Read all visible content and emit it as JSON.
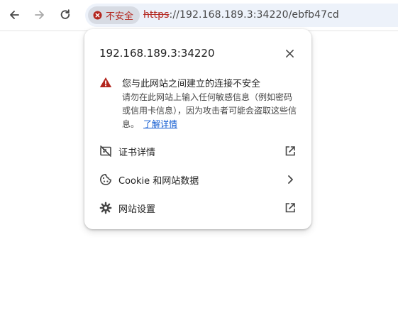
{
  "toolbar": {
    "back_icon": "arrow-left-icon",
    "forward_icon": "arrow-right-icon",
    "reload_icon": "reload-icon"
  },
  "omnibox": {
    "security_chip_label": "不安全",
    "url_scheme": "https",
    "url_rest": "://192.168.189.3:34220/ebfb47cd"
  },
  "popup": {
    "title": "192.168.189.3:34220",
    "warning_heading": "您与此网站之间建立的连接不安全",
    "warning_body": "请勿在此网站上输入任何敏感信息（例如密码或信用卡信息），因为攻击者可能会盗取这些信息。",
    "learn_more": "了解详情",
    "items": [
      {
        "label": "证书详情",
        "icon": "certificate-error-icon",
        "trail": "external-link-icon"
      },
      {
        "label": "Cookie 和网站数据",
        "icon": "cookie-icon",
        "trail": "chevron-right-icon"
      },
      {
        "label": "网站设置",
        "icon": "gear-icon",
        "trail": "external-link-icon"
      }
    ]
  },
  "colors": {
    "danger": "#b3261e",
    "link": "#0b57d0",
    "omnibox_bg": "#edf2fa",
    "chip_bg": "#d7dbe3"
  }
}
